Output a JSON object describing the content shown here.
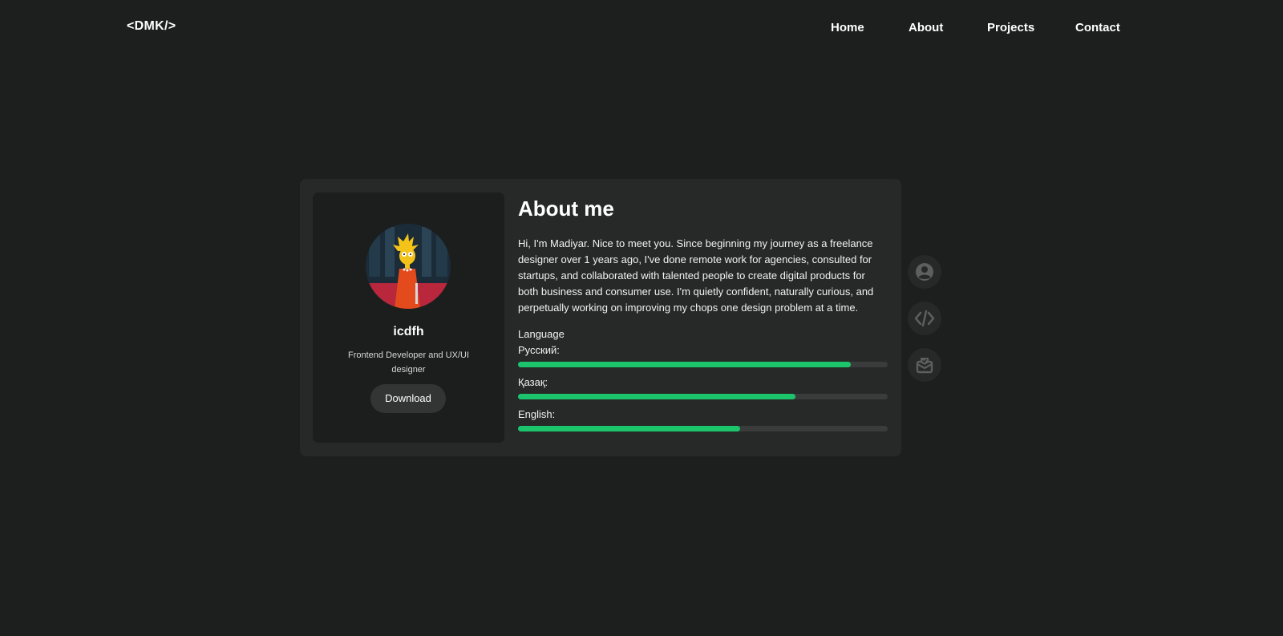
{
  "header": {
    "logo": "<DMK/>",
    "nav": {
      "home": "Home",
      "about": "About",
      "projects": "Projects",
      "contact": "Contact"
    }
  },
  "profile": {
    "name": "icdfh",
    "role": "Frontend Developer and UX/UI designer",
    "download_label": "Download"
  },
  "about": {
    "title": "About me",
    "text": "Hi, I'm Madiyar. Nice to meet you. Since beginning my journey as a freelance designer over 1 years ago, I've done remote work for agencies, consulted for startups, and collaborated with talented people to create digital products for both business and consumer use. I'm quietly confident, naturally curious, and perpetually working on improving my chops one design problem at a time.",
    "language_label": "Language",
    "languages": [
      {
        "name": "Русский:",
        "level": 0.9
      },
      {
        "name": "Қазақ:",
        "level": 0.75
      },
      {
        "name": "English:",
        "level": 0.6
      }
    ]
  },
  "side_nav": {
    "icons": [
      "user-icon",
      "code-icon",
      "mail-icon"
    ]
  },
  "colors": {
    "background": "#1d1f1e",
    "card": "#262927",
    "accent": "#1cc46b"
  }
}
